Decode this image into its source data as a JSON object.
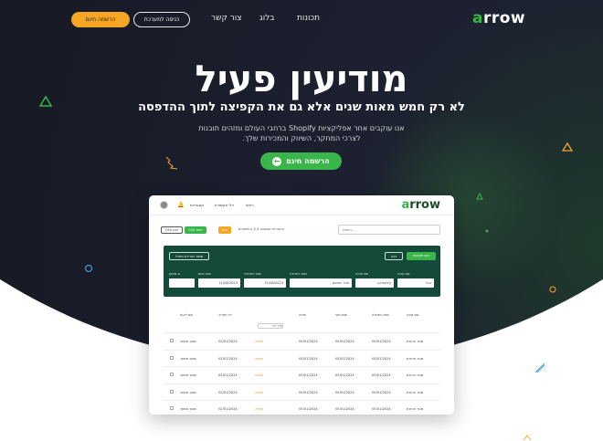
{
  "nav": {
    "logo_text": "arrow",
    "items": [
      "תכונות",
      "בלוג",
      "צור קשר"
    ],
    "login_label": "כניסה למערכת",
    "signup_label": "הרשמה חינם"
  },
  "hero": {
    "title": "מודיעין פעיל",
    "subtitle": "לא רק חמש מאות שנים אלא גם את הקפיצה לתוך ההדפסה",
    "description_line1": "אנו עוקבים אחר אפליקציות Shopify ברחבי העולם ומזהים תובנות",
    "description_line2": "לצרכי המחקר, השיווק והמכירות שלך.",
    "cta_label": "הרשמה חינם",
    "cta_icon": "arrow-left-icon"
  },
  "app": {
    "logo_text": "arrow",
    "nav": [
      "ראשי",
      "כלי חקשורת",
      "קטגוריות"
    ],
    "search_placeholder": "חיפוש...",
    "results_text": "קטגוריות שנמצאו 2,3 מ משתנים",
    "badge_label": "חדש",
    "button_green": "CSV ייצוא",
    "button_outline": "CSV ייצא",
    "filter": {
      "btn_primary": "הצג תוצאות",
      "btn_outline": "נקה",
      "btn_save": "שמור כברירת מחדל",
      "labels": [
        "שם קוטג",
        "שם שיטה",
        "שנת התחלה",
        "שנת התחלה",
        "שנת סיום",
        "מ-מתקן"
      ],
      "values": [
        "הכל",
        "קלאסיקה",
        "מכל הזמנים",
        "11/08/2023",
        "11/08/2023",
        ""
      ]
    },
    "table": {
      "headers": [
        "שם קוטג",
        "שנת התחלה",
        "שנת סוף",
        "שיטה",
        "כל תאריך",
        "שם לקוח"
      ],
      "dropdown_label": "מיין לפי",
      "rows": [
        [
          "מגזר חטיבת",
          "05/01/2024",
          "05/01/2024",
          "05/01/2024",
          "אומיה",
          "02/01/2024",
          "מוסך ממוזך"
        ],
        [
          "מגזר חטיבת",
          "05/01/2024",
          "05/01/2024",
          "05/01/2024",
          "אומיה",
          "02/01/2024",
          "מוסך ממוזך"
        ],
        [
          "מגזר חטיבת",
          "05/01/2024",
          "05/01/2024",
          "05/01/2024",
          "אומיה",
          "02/01/2024",
          "מוסך ממוזך"
        ],
        [
          "מגזר חטיבת",
          "05/01/2024",
          "05/01/2024",
          "05/01/2024",
          "אומיה",
          "02/01/2024",
          "מוסך ממוזך"
        ],
        [
          "מגזר חטיבת",
          "05/01/2024",
          "05/01/2024",
          "05/01/2024",
          "אומיה",
          "02/01/2024",
          "מוסך ממוזך"
        ]
      ]
    }
  },
  "colors": {
    "accent_green": "#39b54a",
    "accent_orange": "#f6a623",
    "dark_bg": "#171a24",
    "filter_bg": "#134a3a"
  }
}
